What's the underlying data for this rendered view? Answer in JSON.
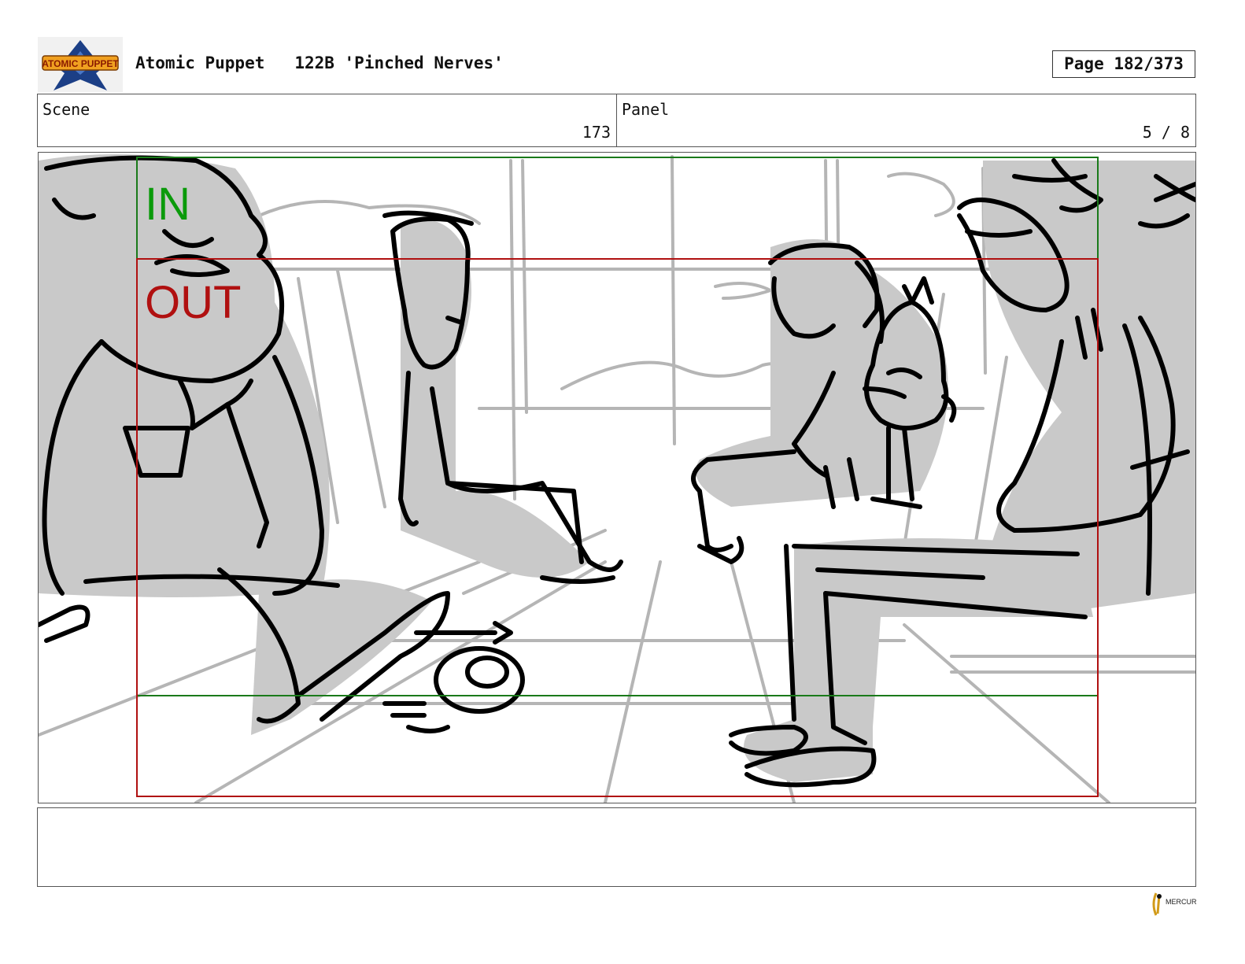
{
  "header": {
    "logo_text": "ATOMIC PUPPET",
    "show_title": "Atomic Puppet",
    "episode": "122B 'Pinched Nerves'",
    "page_label": "Page 182/373"
  },
  "info": {
    "scene_label": "Scene",
    "scene_value": "173",
    "panel_label": "Panel",
    "panel_value": "5 / 8"
  },
  "frame": {
    "in_label": "IN",
    "out_label": "OUT",
    "in_color": "#0a9a0a",
    "out_color": "#b01010"
  },
  "notes": {
    "text": ""
  },
  "footer": {
    "studio_logo_text": "MERCURY"
  }
}
